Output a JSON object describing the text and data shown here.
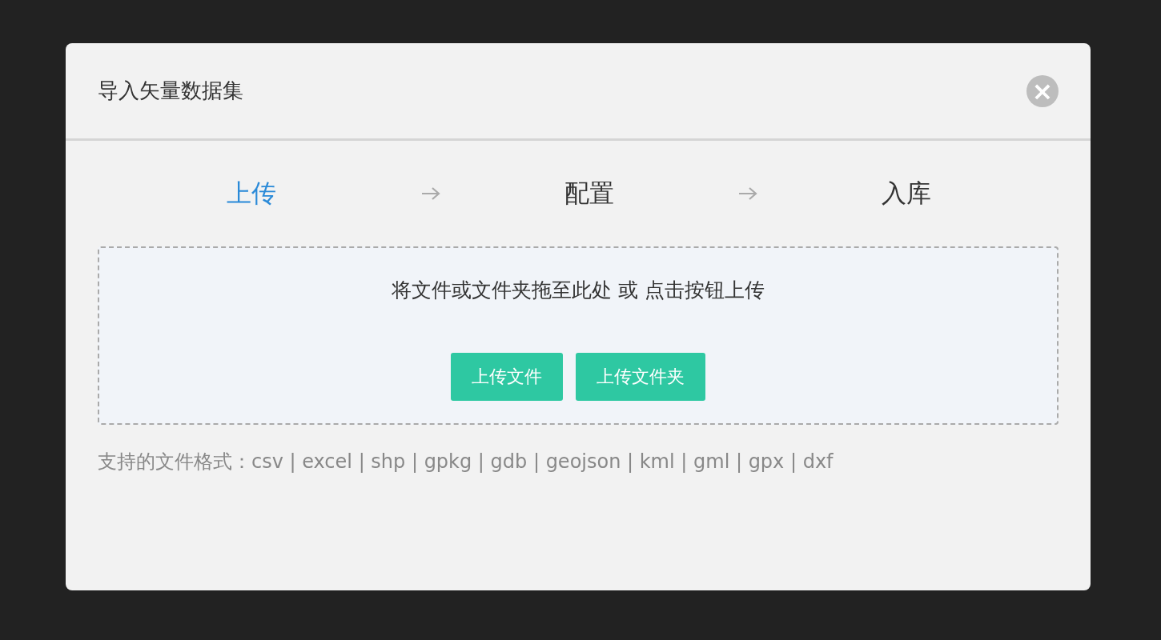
{
  "dialog": {
    "title": "导入矢量数据集",
    "close": "×"
  },
  "steps": [
    {
      "label": "上传",
      "selected": true
    },
    {
      "label": "配置",
      "selected": false
    },
    {
      "label": "入库",
      "selected": false
    }
  ],
  "dropzone": {
    "hint": "将文件或文件夹拖至此处 或 点击按钮上传",
    "buttons": [
      "上传文件",
      "上传文件夹"
    ]
  },
  "formats": "支持的文件格式：csv | excel | shp | gpkg | gdb | geojson | kml | gml | gpx | dxf"
}
